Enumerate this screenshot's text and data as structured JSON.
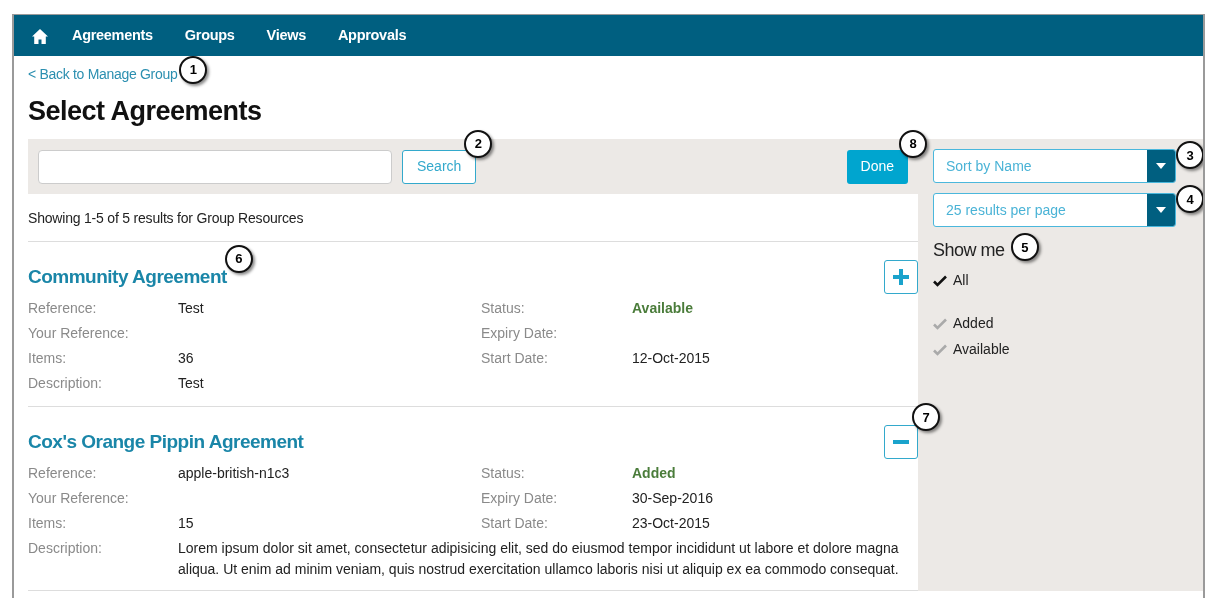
{
  "nav": {
    "items": [
      {
        "label": "Agreements"
      },
      {
        "label": "Groups"
      },
      {
        "label": "Views"
      },
      {
        "label": "Approvals"
      }
    ]
  },
  "back_link": {
    "label": "< Back to Manage Group",
    "callout": "1"
  },
  "title": "Select Agreements",
  "search": {
    "button": "Search",
    "callout": "2"
  },
  "done": {
    "label": "Done",
    "callout": "8"
  },
  "sort": {
    "value": "Sort by Name",
    "callout": "3"
  },
  "per_page": {
    "value": "25 results per page",
    "callout": "4"
  },
  "filter": {
    "title": "Show me",
    "callout": "5",
    "options": [
      {
        "label": "All",
        "checked": true
      },
      {
        "label": "Added",
        "checked": false
      },
      {
        "label": "Available",
        "checked": false
      }
    ]
  },
  "summary": "Showing 1-5 of 5 results for Group Resources",
  "agreements": [
    {
      "title": "Community Agreement",
      "callout": "6",
      "kind": "add",
      "details": [
        {
          "label": "Reference:",
          "value": "Test"
        },
        {
          "label": "Status:",
          "value": "Available",
          "kind": "status"
        },
        {
          "label": "Your Reference:"
        },
        {
          "label": "Expiry Date:"
        },
        {
          "label": "Items:",
          "value": "36"
        },
        {
          "label": "Start Date:",
          "value": "12-Oct-2015"
        },
        {
          "label": "Description:",
          "value": "Test",
          "kind": "description"
        }
      ]
    },
    {
      "title": "Cox's Orange Pippin Agreement",
      "kind": "remove",
      "action_callout": "7",
      "details": [
        {
          "label": "Reference:",
          "value": "apple-british-n1c3"
        },
        {
          "label": "Status:",
          "value": "Added",
          "kind": "status"
        },
        {
          "label": "Your Reference:"
        },
        {
          "label": "Expiry Date:",
          "value": "30-Sep-2016"
        },
        {
          "label": "Items:",
          "value": "15"
        },
        {
          "label": "Start Date:",
          "value": "23-Oct-2015"
        },
        {
          "label": "Description:",
          "value": "Lorem ipsum dolor sit amet, consectetur adipisicing elit, sed do eiusmod tempor incididunt ut labore et dolore magna aliqua. Ut enim ad minim veniam, quis nostrud exercitation ullamco laboris nisi ut aliquip ex ea commodo consequat.",
          "kind": "description"
        }
      ]
    }
  ]
}
